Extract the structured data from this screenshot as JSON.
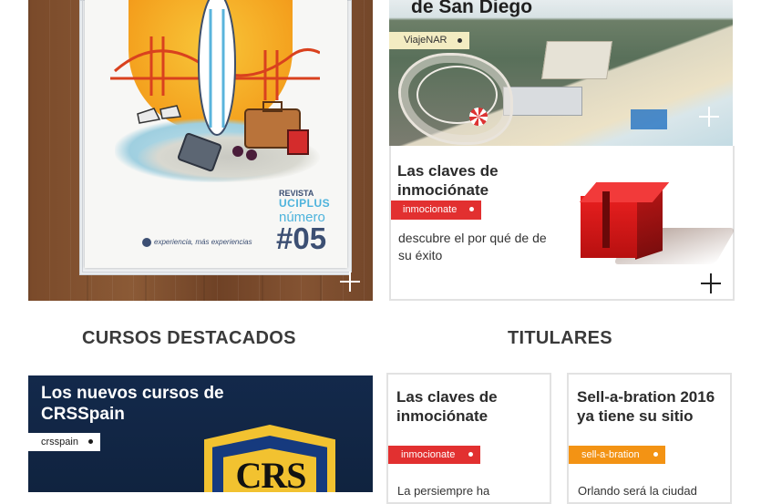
{
  "magazine": {
    "tagline": "experiencia, más experiencias",
    "revista": "REVISTA",
    "brand": "UCIPLUS",
    "numero": "número",
    "issue": "#05"
  },
  "sandiego": {
    "title": "de San Diego",
    "tag": "ViajeNAR"
  },
  "inmocionate": {
    "title": "Las claves de inmociónate",
    "tag": "inmocionate",
    "description": "descubre el por qué de de su éxito"
  },
  "sections": {
    "cursos_heading": "CURSOS DESTACADOS",
    "titulares_heading": "TITULARES"
  },
  "crs": {
    "title": "Los nuevos cursos de CRSSpain",
    "tag": "crsspain",
    "logo_letters": "CRS"
  },
  "titulares": [
    {
      "title": "Las claves de inmociónate",
      "tag": "inmocionate",
      "excerpt": "La persiempre ha"
    },
    {
      "title": "Sell-a-bration 2016 ya tiene su sitio",
      "tag": "sell-a-bration",
      "excerpt": "Orlando será la ciudad"
    }
  ],
  "colors": {
    "tag_red": "#e23030",
    "tag_orange": "#f39314",
    "tag_cream": "#f3ecc2",
    "crs_navy": "#13294b"
  }
}
